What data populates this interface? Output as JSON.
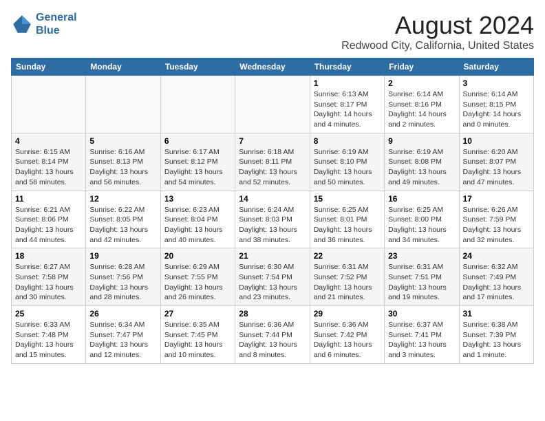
{
  "logo": {
    "line1": "General",
    "line2": "Blue"
  },
  "title": "August 2024",
  "subtitle": "Redwood City, California, United States",
  "weekdays": [
    "Sunday",
    "Monday",
    "Tuesday",
    "Wednesday",
    "Thursday",
    "Friday",
    "Saturday"
  ],
  "weeks": [
    [
      {
        "day": "",
        "info": ""
      },
      {
        "day": "",
        "info": ""
      },
      {
        "day": "",
        "info": ""
      },
      {
        "day": "",
        "info": ""
      },
      {
        "day": "1",
        "info": "Sunrise: 6:13 AM\nSunset: 8:17 PM\nDaylight: 14 hours\nand 4 minutes."
      },
      {
        "day": "2",
        "info": "Sunrise: 6:14 AM\nSunset: 8:16 PM\nDaylight: 14 hours\nand 2 minutes."
      },
      {
        "day": "3",
        "info": "Sunrise: 6:14 AM\nSunset: 8:15 PM\nDaylight: 14 hours\nand 0 minutes."
      }
    ],
    [
      {
        "day": "4",
        "info": "Sunrise: 6:15 AM\nSunset: 8:14 PM\nDaylight: 13 hours\nand 58 minutes."
      },
      {
        "day": "5",
        "info": "Sunrise: 6:16 AM\nSunset: 8:13 PM\nDaylight: 13 hours\nand 56 minutes."
      },
      {
        "day": "6",
        "info": "Sunrise: 6:17 AM\nSunset: 8:12 PM\nDaylight: 13 hours\nand 54 minutes."
      },
      {
        "day": "7",
        "info": "Sunrise: 6:18 AM\nSunset: 8:11 PM\nDaylight: 13 hours\nand 52 minutes."
      },
      {
        "day": "8",
        "info": "Sunrise: 6:19 AM\nSunset: 8:10 PM\nDaylight: 13 hours\nand 50 minutes."
      },
      {
        "day": "9",
        "info": "Sunrise: 6:19 AM\nSunset: 8:08 PM\nDaylight: 13 hours\nand 49 minutes."
      },
      {
        "day": "10",
        "info": "Sunrise: 6:20 AM\nSunset: 8:07 PM\nDaylight: 13 hours\nand 47 minutes."
      }
    ],
    [
      {
        "day": "11",
        "info": "Sunrise: 6:21 AM\nSunset: 8:06 PM\nDaylight: 13 hours\nand 44 minutes."
      },
      {
        "day": "12",
        "info": "Sunrise: 6:22 AM\nSunset: 8:05 PM\nDaylight: 13 hours\nand 42 minutes."
      },
      {
        "day": "13",
        "info": "Sunrise: 6:23 AM\nSunset: 8:04 PM\nDaylight: 13 hours\nand 40 minutes."
      },
      {
        "day": "14",
        "info": "Sunrise: 6:24 AM\nSunset: 8:03 PM\nDaylight: 13 hours\nand 38 minutes."
      },
      {
        "day": "15",
        "info": "Sunrise: 6:25 AM\nSunset: 8:01 PM\nDaylight: 13 hours\nand 36 minutes."
      },
      {
        "day": "16",
        "info": "Sunrise: 6:25 AM\nSunset: 8:00 PM\nDaylight: 13 hours\nand 34 minutes."
      },
      {
        "day": "17",
        "info": "Sunrise: 6:26 AM\nSunset: 7:59 PM\nDaylight: 13 hours\nand 32 minutes."
      }
    ],
    [
      {
        "day": "18",
        "info": "Sunrise: 6:27 AM\nSunset: 7:58 PM\nDaylight: 13 hours\nand 30 minutes."
      },
      {
        "day": "19",
        "info": "Sunrise: 6:28 AM\nSunset: 7:56 PM\nDaylight: 13 hours\nand 28 minutes."
      },
      {
        "day": "20",
        "info": "Sunrise: 6:29 AM\nSunset: 7:55 PM\nDaylight: 13 hours\nand 26 minutes."
      },
      {
        "day": "21",
        "info": "Sunrise: 6:30 AM\nSunset: 7:54 PM\nDaylight: 13 hours\nand 23 minutes."
      },
      {
        "day": "22",
        "info": "Sunrise: 6:31 AM\nSunset: 7:52 PM\nDaylight: 13 hours\nand 21 minutes."
      },
      {
        "day": "23",
        "info": "Sunrise: 6:31 AM\nSunset: 7:51 PM\nDaylight: 13 hours\nand 19 minutes."
      },
      {
        "day": "24",
        "info": "Sunrise: 6:32 AM\nSunset: 7:49 PM\nDaylight: 13 hours\nand 17 minutes."
      }
    ],
    [
      {
        "day": "25",
        "info": "Sunrise: 6:33 AM\nSunset: 7:48 PM\nDaylight: 13 hours\nand 15 minutes."
      },
      {
        "day": "26",
        "info": "Sunrise: 6:34 AM\nSunset: 7:47 PM\nDaylight: 13 hours\nand 12 minutes."
      },
      {
        "day": "27",
        "info": "Sunrise: 6:35 AM\nSunset: 7:45 PM\nDaylight: 13 hours\nand 10 minutes."
      },
      {
        "day": "28",
        "info": "Sunrise: 6:36 AM\nSunset: 7:44 PM\nDaylight: 13 hours\nand 8 minutes."
      },
      {
        "day": "29",
        "info": "Sunrise: 6:36 AM\nSunset: 7:42 PM\nDaylight: 13 hours\nand 6 minutes."
      },
      {
        "day": "30",
        "info": "Sunrise: 6:37 AM\nSunset: 7:41 PM\nDaylight: 13 hours\nand 3 minutes."
      },
      {
        "day": "31",
        "info": "Sunrise: 6:38 AM\nSunset: 7:39 PM\nDaylight: 13 hours\nand 1 minute."
      }
    ]
  ]
}
